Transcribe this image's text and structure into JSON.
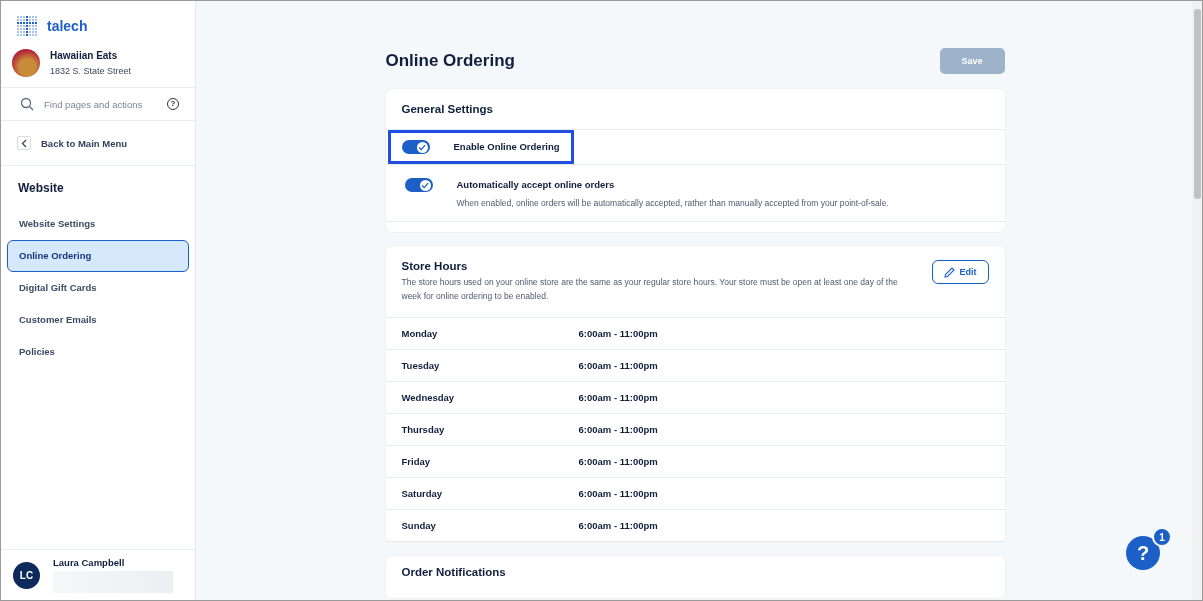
{
  "brand": {
    "name": "talech"
  },
  "store": {
    "name": "Hawaiian Eats",
    "address": "1832 S. State Street"
  },
  "search": {
    "placeholder": "Find pages and actions",
    "help_glyph": "?"
  },
  "back": {
    "label": "Back to Main Menu"
  },
  "sidebar": {
    "section": "Website",
    "items": [
      {
        "label": "Website Settings",
        "selected": false
      },
      {
        "label": "Online Ordering",
        "selected": true
      },
      {
        "label": "Digital Gift Cards",
        "selected": false
      },
      {
        "label": "Customer Emails",
        "selected": false
      },
      {
        "label": "Policies",
        "selected": false
      }
    ]
  },
  "user": {
    "initials": "LC",
    "name": "Laura Campbell"
  },
  "page": {
    "title": "Online Ordering",
    "save_button": {
      "label": "Save",
      "disabled": true
    }
  },
  "general_settings": {
    "title": "General Settings",
    "settings": [
      {
        "label": "Enable Online Ordering",
        "on": true,
        "highlighted": true
      },
      {
        "label": "Automatically accept online orders",
        "description": "When enabled, online orders will be automatically accepted, rather than manually accepted from your point-of-sale.",
        "on": true,
        "highlighted": false
      }
    ]
  },
  "store_hours": {
    "title": "Store Hours",
    "description": "The store hours used on your online store are the same as your regular store hours. Your store must be open at least one day of the week for online ordering to be enabled.",
    "edit_button": "Edit",
    "rows": [
      {
        "day": "Monday",
        "hours": "6:00am - 11:00pm"
      },
      {
        "day": "Tuesday",
        "hours": "6:00am - 11:00pm"
      },
      {
        "day": "Wednesday",
        "hours": "6:00am - 11:00pm"
      },
      {
        "day": "Thursday",
        "hours": "6:00am - 11:00pm"
      },
      {
        "day": "Friday",
        "hours": "6:00am - 11:00pm"
      },
      {
        "day": "Saturday",
        "hours": "6:00am - 11:00pm"
      },
      {
        "day": "Sunday",
        "hours": "6:00am - 11:00pm"
      }
    ]
  },
  "order_notifications": {
    "title": "Order Notifications"
  },
  "help": {
    "glyph": "?",
    "badge": "1"
  }
}
